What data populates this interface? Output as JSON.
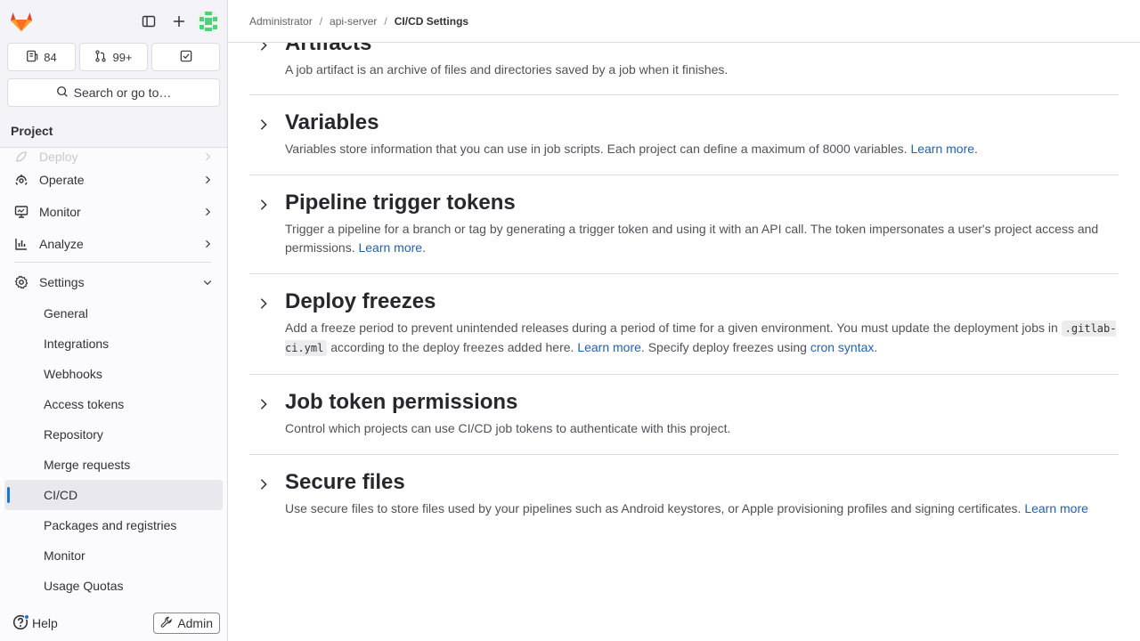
{
  "sidebar": {
    "issues_count": "84",
    "mr_count": "99+",
    "search_label": "Search or go to…",
    "section_title": "Project",
    "nav_faded": "Deploy",
    "nav": [
      {
        "label": "Operate",
        "icon": "deployments-icon"
      },
      {
        "label": "Monitor",
        "icon": "monitor-icon"
      },
      {
        "label": "Analyze",
        "icon": "chart-icon"
      }
    ],
    "settings_label": "Settings",
    "settings_items": [
      "General",
      "Integrations",
      "Webhooks",
      "Access tokens",
      "Repository",
      "Merge requests",
      "CI/CD",
      "Packages and registries",
      "Monitor",
      "Usage Quotas"
    ],
    "help_label": "Help",
    "admin_label": "Admin"
  },
  "breadcrumb": {
    "items": [
      "Administrator",
      "api-server",
      "CI/CD Settings"
    ],
    "separator": "/"
  },
  "sections": {
    "artifacts": {
      "title": "Artifacts",
      "desc": "A job artifact is an archive of files and directories saved by a job when it finishes."
    },
    "variables": {
      "title": "Variables",
      "desc": "Variables store information that you can use in job scripts. Each project can define a maximum of 8000 variables.",
      "link": "Learn more",
      "after": "."
    },
    "trigger": {
      "title": "Pipeline trigger tokens",
      "desc": "Trigger a pipeline for a branch or tag by generating a trigger token and using it with an API call. The token impersonates a user's project access and permissions.",
      "link": "Learn more",
      "after": "."
    },
    "freezes": {
      "title": "Deploy freezes",
      "desc1": "Add a freeze period to prevent unintended releases during a period of time for a given environment. You must update the deployment jobs in",
      "code": ".gitlab-ci.yml",
      "desc2": "according to the deploy freezes added here.",
      "link": "Learn more",
      "desc3": ". Specify deploy freezes using",
      "link2": "cron syntax",
      "after": "."
    },
    "jobtoken": {
      "title": "Job token permissions",
      "desc": "Control which projects can use CI/CD job tokens to authenticate with this project."
    },
    "securefiles": {
      "title": "Secure files",
      "desc": "Use secure files to store files used by your pipelines such as Android keystores, or Apple provisioning profiles and signing certificates.",
      "link": "Learn more"
    }
  },
  "colors": {
    "accent": "#1f75cb",
    "link": "#1f61b6",
    "logo": "#e24329"
  }
}
